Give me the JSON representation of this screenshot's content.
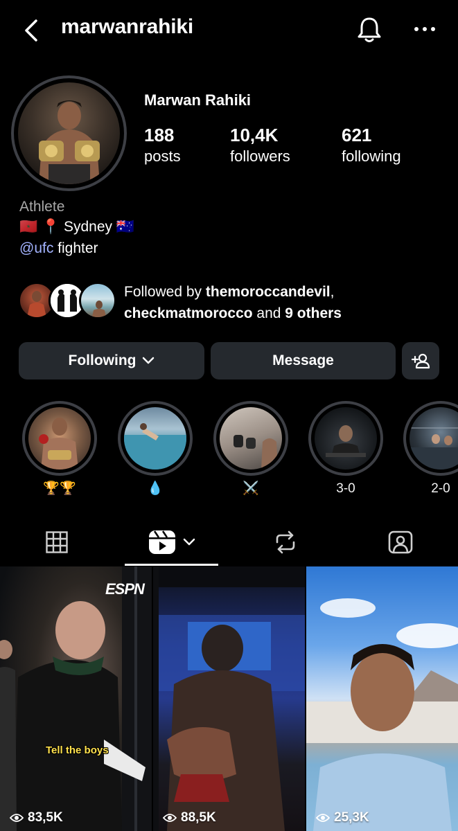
{
  "header": {
    "username": "marwanrahiki"
  },
  "profile": {
    "display_name": "Marwan Rahiki",
    "stats": {
      "posts_value": "188",
      "posts_label": "posts",
      "followers_value": "10,4K",
      "followers_label": "followers",
      "following_value": "621",
      "following_label": "following"
    }
  },
  "bio": {
    "category": "Athlete",
    "line1": "🇲🇦 📍 Sydney 🇦🇺",
    "mention": "@ufc",
    "line2_rest": " fighter"
  },
  "followed_by": {
    "prefix": "Followed by ",
    "user1": "themoroccandevil",
    "sep": ",",
    "user2": "checkmatmorocco",
    "and": " and ",
    "others": "9 others"
  },
  "buttons": {
    "following": "Following",
    "message": "Message"
  },
  "highlights": [
    {
      "label": "🏆🏆"
    },
    {
      "label": "💧"
    },
    {
      "label": "⚔️"
    },
    {
      "label": "3-0"
    },
    {
      "label": "2-0"
    }
  ],
  "reels": [
    {
      "views": "83,5K",
      "overlay_logo": "ESPN",
      "caption": "Tell the boys"
    },
    {
      "views": "88,5K"
    },
    {
      "views": "25,3K"
    }
  ],
  "colors": {
    "background": "#000000",
    "button_bg": "#25292e",
    "mention": "#a3b3ff",
    "muted": "#a8a8a8"
  }
}
